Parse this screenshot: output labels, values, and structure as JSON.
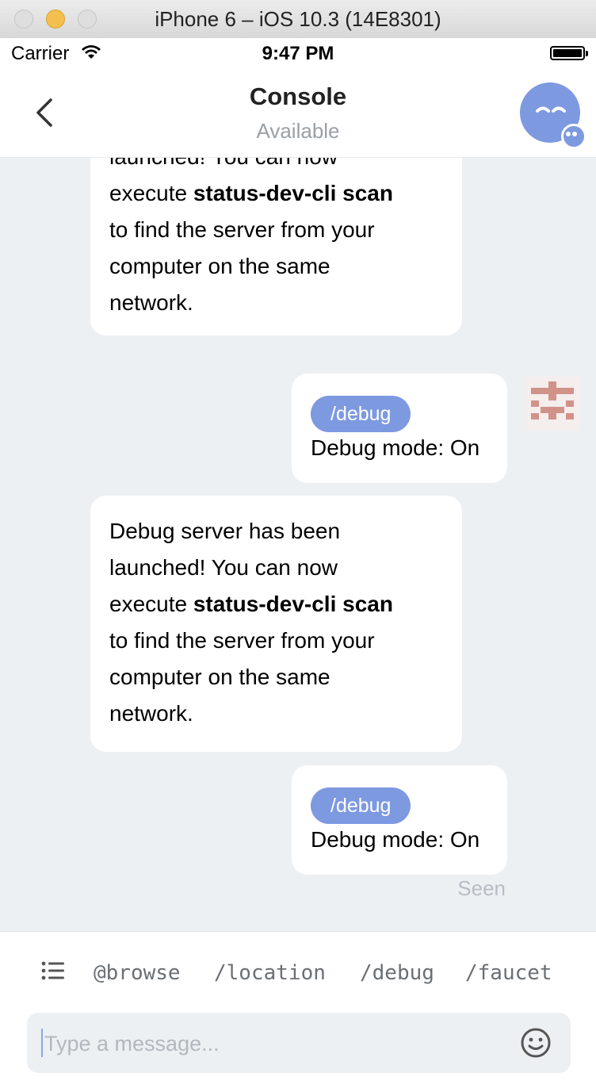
{
  "window": {
    "title": "iPhone 6 – iOS 10.3 (14E8301)"
  },
  "status_bar": {
    "carrier": "Carrier",
    "time": "9:47 PM"
  },
  "header": {
    "title": "Console",
    "subtitle": "Available"
  },
  "messages": [
    {
      "type": "incoming",
      "line1": "launched! You can now",
      "line2_pre": "execute ",
      "line2_bold": "status-dev-cli scan",
      "line3": "to find the server from your",
      "line4": "computer on the same",
      "line5": "network."
    },
    {
      "type": "outgoing",
      "command": "/debug",
      "text": "Debug mode: On"
    },
    {
      "type": "incoming",
      "line0": "Debug server has been",
      "line1": "launched! You can now",
      "line2_pre": "execute ",
      "line2_bold": "status-dev-cli scan",
      "line3": "to find the server from your",
      "line4": "computer on the same",
      "line5": "network."
    },
    {
      "type": "outgoing",
      "command": "/debug",
      "text": "Debug mode: On"
    }
  ],
  "seen_label": "Seen",
  "suggestions": [
    "@browse",
    "/location",
    "/debug",
    "/faucet"
  ],
  "input": {
    "placeholder": "Type a message...",
    "value": ""
  },
  "colors": {
    "accent": "#7d99e0",
    "chat_bg": "#edf0f3",
    "muted": "#9aa0a6"
  }
}
